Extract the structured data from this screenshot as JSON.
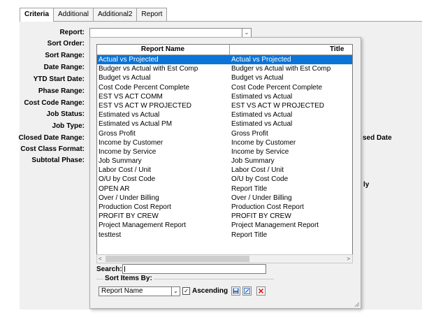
{
  "tabs": [
    "Criteria",
    "Additional",
    "Additional2",
    "Report"
  ],
  "labels": [
    "Report:",
    "Sort Order:",
    "Sort Range:",
    "Date Range:",
    "YTD Start Date:",
    "Phase Range:",
    "Cost Code Range:",
    "Job Status:",
    "Job Type:",
    "Closed Date Range:",
    "Cost Class Format:",
    "Subtotal Phase:"
  ],
  "partial_texts": {
    "closed_date": "sed Date",
    "only": "ly"
  },
  "report_select": {
    "value": "",
    "arrow": "⌄"
  },
  "picker": {
    "columns": [
      "Report Name",
      "Title"
    ],
    "rows": [
      {
        "name": "Actual vs Projected",
        "title": "Actual vs Projected"
      },
      {
        "name": "Budger vs Actual with Est Comp",
        "title": "Budger vs Actual with Est Comp"
      },
      {
        "name": "Budget vs Actual",
        "title": "Budget vs Actual"
      },
      {
        "name": "Cost Code Percent Complete",
        "title": "Cost Code Percent Complete"
      },
      {
        "name": "EST VS ACT COMM",
        "title": "Estimated vs Actual"
      },
      {
        "name": "EST VS ACT W PROJECTED",
        "title": "EST VS ACT W PROJECTED"
      },
      {
        "name": "Estimated vs Actual",
        "title": "Estimated vs Actual"
      },
      {
        "name": "Estimated vs Actual PM",
        "title": "Estimated vs Actual"
      },
      {
        "name": "Gross Profit",
        "title": "Gross Profit"
      },
      {
        "name": "Income by Customer",
        "title": "Income by Customer"
      },
      {
        "name": "Income by Service",
        "title": "Income by Service"
      },
      {
        "name": "Job Summary",
        "title": "Job Summary"
      },
      {
        "name": "Labor Cost / Unit",
        "title": "Labor Cost / Unit"
      },
      {
        "name": "O/U by Cost Code",
        "title": "O/U by Cost Code"
      },
      {
        "name": "OPEN AR",
        "title": "Report Title"
      },
      {
        "name": "Over / Under Billing",
        "title": "Over / Under Billing"
      },
      {
        "name": "Production Cost Report",
        "title": "Production Cost Report"
      },
      {
        "name": "PROFIT BY CREW",
        "title": "PROFIT BY CREW"
      },
      {
        "name": "Project Management Report",
        "title": "Project Management Report"
      },
      {
        "name": "testtest",
        "title": "Report Title"
      }
    ],
    "selected_index": 0,
    "scroll_left": "<",
    "scroll_right": ">",
    "search_label": "Search:",
    "search_value": "",
    "sort_group_label": "Sort Items By:",
    "sort_by": "Report Name",
    "ascending_label": "Ascending",
    "ascending_checked": true,
    "check_mark": "✓",
    "icons": [
      "save-icon",
      "edit-icon",
      "delete-icon"
    ]
  },
  "colors": {
    "selection": "#0a74d8",
    "panel": "#f0f0f0"
  }
}
